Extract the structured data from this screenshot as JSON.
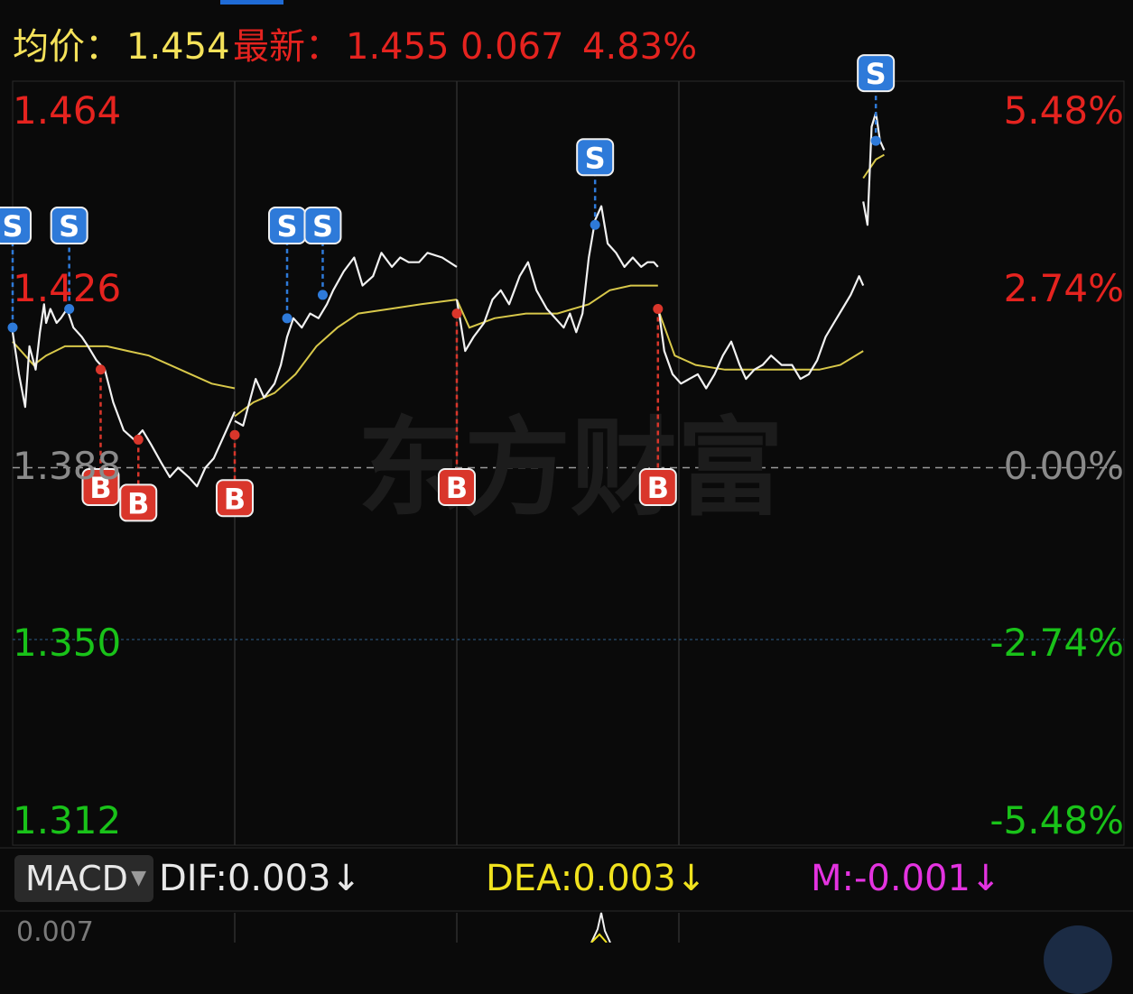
{
  "header": {
    "avg_label": "均价：",
    "avg_value": "1.454",
    "latest_label": "最新：",
    "latest_value": "1.455",
    "change": "0.067",
    "change_pct": "4.83%"
  },
  "watermark": "东方财富",
  "colors": {
    "up": "#e5231f",
    "down": "#19c219",
    "avg_header": "#f5e25a",
    "price_line": "#f2f2f2",
    "avg_line": "#d8c84a",
    "buy": "#d9362b",
    "sell": "#2e7ad9",
    "macd_dea": "#f0e21e",
    "macd_m": "#e433e0",
    "neutral": "#8a8a8a"
  },
  "chart_data": {
    "type": "line",
    "title": "",
    "x_label": "",
    "y_label": "",
    "ylim": [
      1.312,
      1.464
    ],
    "pct_range": [
      -5.48,
      5.48
    ],
    "prev_close": 1.388,
    "y_ticks": [
      "1.464",
      "1.426",
      "1.388",
      "1.350",
      "1.312"
    ],
    "pct_ticks": [
      "5.48%",
      "2.74%",
      "0.00%",
      "-2.74%",
      "-5.48%"
    ],
    "day_count": 4,
    "price_series": [
      [
        0.0,
        1.417
      ],
      [
        0.3,
        1.408
      ],
      [
        0.6,
        1.401
      ],
      [
        0.8,
        1.414
      ],
      [
        1.1,
        1.409
      ],
      [
        1.3,
        1.417
      ],
      [
        1.5,
        1.423
      ],
      [
        1.6,
        1.419
      ],
      [
        1.8,
        1.422
      ],
      [
        2.1,
        1.419
      ],
      [
        2.3,
        1.42
      ],
      [
        2.6,
        1.422
      ],
      [
        2.9,
        1.418
      ],
      [
        3.3,
        1.416
      ],
      [
        3.6,
        1.414
      ],
      [
        4.0,
        1.411
      ],
      [
        4.4,
        1.409
      ],
      [
        4.8,
        1.402
      ],
      [
        5.3,
        1.396
      ],
      [
        5.8,
        1.394
      ],
      [
        6.2,
        1.396
      ],
      [
        6.6,
        1.393
      ],
      [
        7.1,
        1.389
      ],
      [
        7.5,
        1.386
      ],
      [
        7.9,
        1.388
      ],
      [
        8.4,
        1.386
      ],
      [
        8.8,
        1.384
      ],
      [
        9.2,
        1.388
      ],
      [
        9.6,
        1.39
      ],
      [
        10.0,
        1.394
      ],
      [
        10.4,
        1.398
      ],
      [
        10.6,
        1.4
      ],
      [
        10.6,
        1.398
      ],
      [
        11.0,
        1.397
      ],
      [
        11.3,
        1.402
      ],
      [
        11.6,
        1.407
      ],
      [
        12.0,
        1.403
      ],
      [
        12.5,
        1.406
      ],
      [
        12.8,
        1.41
      ],
      [
        13.1,
        1.416
      ],
      [
        13.4,
        1.42
      ],
      [
        13.8,
        1.418
      ],
      [
        14.2,
        1.421
      ],
      [
        14.6,
        1.42
      ],
      [
        15.0,
        1.423
      ],
      [
        15.3,
        1.426
      ],
      [
        15.8,
        1.43
      ],
      [
        16.3,
        1.433
      ],
      [
        16.7,
        1.427
      ],
      [
        17.2,
        1.429
      ],
      [
        17.6,
        1.434
      ],
      [
        18.1,
        1.431
      ],
      [
        18.5,
        1.433
      ],
      [
        18.9,
        1.432
      ],
      [
        19.4,
        1.432
      ],
      [
        19.8,
        1.434
      ],
      [
        20.5,
        1.433
      ],
      [
        21.2,
        1.431
      ],
      [
        21.2,
        1.424
      ],
      [
        21.6,
        1.413
      ],
      [
        22.0,
        1.416
      ],
      [
        22.5,
        1.419
      ],
      [
        22.9,
        1.424
      ],
      [
        23.3,
        1.426
      ],
      [
        23.7,
        1.423
      ],
      [
        24.2,
        1.429
      ],
      [
        24.6,
        1.432
      ],
      [
        25.0,
        1.426
      ],
      [
        25.5,
        1.422
      ],
      [
        25.9,
        1.42
      ],
      [
        26.3,
        1.418
      ],
      [
        26.6,
        1.421
      ],
      [
        26.9,
        1.417
      ],
      [
        27.2,
        1.421
      ],
      [
        27.5,
        1.433
      ],
      [
        27.8,
        1.441
      ],
      [
        28.1,
        1.444
      ],
      [
        28.4,
        1.436
      ],
      [
        28.8,
        1.434
      ],
      [
        29.2,
        1.431
      ],
      [
        29.6,
        1.433
      ],
      [
        30.0,
        1.431
      ],
      [
        30.3,
        1.432
      ],
      [
        30.6,
        1.432
      ],
      [
        30.8,
        1.431
      ],
      [
        30.8,
        1.423
      ],
      [
        31.1,
        1.413
      ],
      [
        31.5,
        1.408
      ],
      [
        31.9,
        1.406
      ],
      [
        32.3,
        1.407
      ],
      [
        32.7,
        1.408
      ],
      [
        33.1,
        1.405
      ],
      [
        33.5,
        1.408
      ],
      [
        33.9,
        1.412
      ],
      [
        34.3,
        1.415
      ],
      [
        34.7,
        1.41
      ],
      [
        35.0,
        1.407
      ],
      [
        35.4,
        1.409
      ],
      [
        35.8,
        1.41
      ],
      [
        36.2,
        1.412
      ],
      [
        36.7,
        1.41
      ],
      [
        37.2,
        1.41
      ],
      [
        37.6,
        1.407
      ],
      [
        38.0,
        1.408
      ],
      [
        38.4,
        1.411
      ],
      [
        38.8,
        1.416
      ],
      [
        39.2,
        1.419
      ],
      [
        39.6,
        1.422
      ],
      [
        40.0,
        1.425
      ],
      [
        40.4,
        1.429
      ],
      [
        40.6,
        1.427
      ],
      [
        40.6,
        1.445
      ],
      [
        40.8,
        1.44
      ],
      [
        41.0,
        1.461
      ],
      [
        41.2,
        1.464
      ],
      [
        41.4,
        1.458
      ],
      [
        41.6,
        1.456
      ]
    ],
    "avg_series": [
      [
        0.0,
        1.415
      ],
      [
        1.0,
        1.41
      ],
      [
        1.6,
        1.412
      ],
      [
        2.5,
        1.414
      ],
      [
        3.5,
        1.414
      ],
      [
        4.5,
        1.414
      ],
      [
        5.5,
        1.413
      ],
      [
        6.5,
        1.412
      ],
      [
        7.5,
        1.41
      ],
      [
        8.5,
        1.408
      ],
      [
        9.5,
        1.406
      ],
      [
        10.6,
        1.405
      ],
      [
        10.6,
        1.399
      ],
      [
        11.5,
        1.402
      ],
      [
        12.5,
        1.404
      ],
      [
        13.5,
        1.408
      ],
      [
        14.5,
        1.414
      ],
      [
        15.5,
        1.418
      ],
      [
        16.5,
        1.421
      ],
      [
        18.0,
        1.422
      ],
      [
        19.5,
        1.423
      ],
      [
        21.2,
        1.424
      ],
      [
        21.2,
        1.424
      ],
      [
        21.8,
        1.418
      ],
      [
        23.0,
        1.42
      ],
      [
        24.5,
        1.421
      ],
      [
        26.0,
        1.421
      ],
      [
        27.5,
        1.423
      ],
      [
        28.5,
        1.426
      ],
      [
        29.5,
        1.427
      ],
      [
        30.8,
        1.427
      ],
      [
        30.8,
        1.422
      ],
      [
        31.6,
        1.412
      ],
      [
        32.6,
        1.41
      ],
      [
        34.0,
        1.409
      ],
      [
        35.5,
        1.409
      ],
      [
        37.0,
        1.409
      ],
      [
        38.5,
        1.409
      ],
      [
        39.5,
        1.41
      ],
      [
        40.6,
        1.413
      ],
      [
        40.6,
        1.45
      ],
      [
        41.2,
        1.454
      ],
      [
        41.6,
        1.455
      ]
    ],
    "markers": [
      {
        "type": "S",
        "t": 0.0,
        "price": 1.418
      },
      {
        "type": "S",
        "t": 2.7,
        "price": 1.422
      },
      {
        "type": "B",
        "t": 4.2,
        "price": 1.409
      },
      {
        "type": "B",
        "t": 6.0,
        "price": 1.394
      },
      {
        "type": "B",
        "t": 10.6,
        "price": 1.395
      },
      {
        "type": "S",
        "t": 13.1,
        "price": 1.42
      },
      {
        "type": "S",
        "t": 14.8,
        "price": 1.425
      },
      {
        "type": "B",
        "t": 21.2,
        "price": 1.421
      },
      {
        "type": "S",
        "t": 27.8,
        "price": 1.44
      },
      {
        "type": "B",
        "t": 30.8,
        "price": 1.422
      },
      {
        "type": "S",
        "t": 41.2,
        "price": 1.458
      }
    ],
    "macd": {
      "label": "MACD",
      "dif": "DIF:0.003",
      "dea": "DEA:0.003",
      "m": "M:-0.001",
      "arrow": "↓",
      "axis_label": "0.007"
    }
  }
}
